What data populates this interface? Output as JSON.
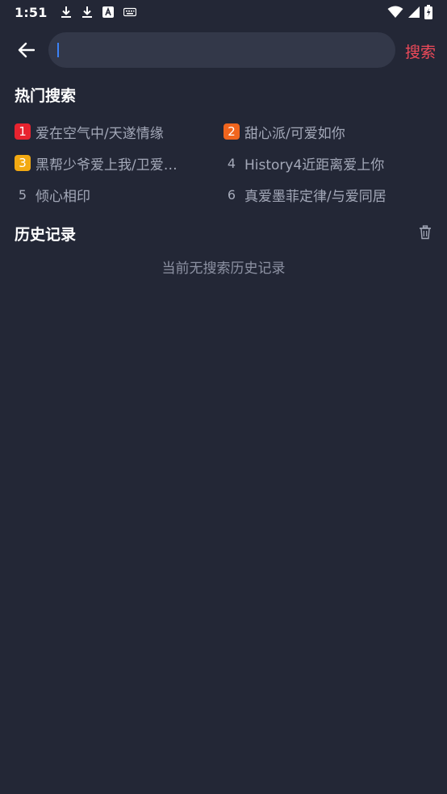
{
  "status_bar": {
    "time": "1:51",
    "left_icons": [
      "download-icon",
      "download-icon",
      "font-a-icon",
      "keyboard-icon"
    ],
    "right_icons": [
      "wifi-icon",
      "cellular-signal-icon",
      "battery-charging-icon"
    ]
  },
  "header": {
    "back_icon": "arrow-left-icon",
    "search_input_value": "",
    "search_button_label": "搜索"
  },
  "hot_search": {
    "title": "热门搜索",
    "items": [
      {
        "rank": "1",
        "label": "爱在空气中/天遂情缘",
        "badge_color": "#e8232f"
      },
      {
        "rank": "2",
        "label": "甜心派/可爱如你",
        "badge_color": "#f0651e"
      },
      {
        "rank": "3",
        "label": "黑帮少爷爱上我/卫爱…",
        "badge_color": "#f2a912"
      },
      {
        "rank": "4",
        "label": "History4近距离爱上你",
        "badge_color": ""
      },
      {
        "rank": "5",
        "label": "倾心相印",
        "badge_color": ""
      },
      {
        "rank": "6",
        "label": "真爱墨菲定律/与爱同居",
        "badge_color": ""
      }
    ]
  },
  "history": {
    "title": "历史记录",
    "clear_icon": "trash-icon",
    "empty_text": "当前无搜索历史记录"
  },
  "colors": {
    "background": "#232736",
    "search_box": "#333849",
    "accent": "#f04a5a",
    "caret": "#3b82f6"
  }
}
